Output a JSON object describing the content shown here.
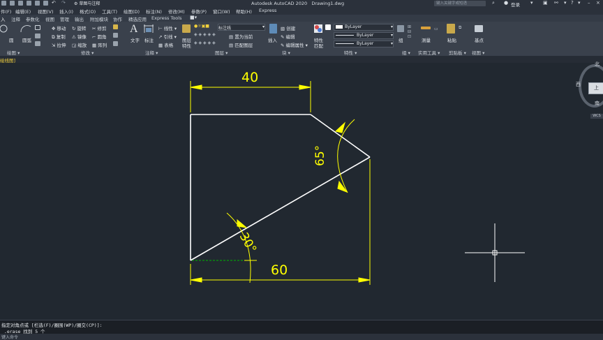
{
  "title": {
    "app_title": "Autodesk AutoCAD 2020",
    "file_name": "Drawing1.dwg",
    "workspace": "草图与注释",
    "search_placeholder": "键入关键字或短语",
    "login": "登录"
  },
  "menu": [
    "件(F)",
    "编辑(E)",
    "视图(V)",
    "插入(I)",
    "格式(O)",
    "工具(T)",
    "绘图(D)",
    "标注(N)",
    "修改(M)",
    "参数(P)",
    "窗口(W)",
    "帮助(H)",
    "Express"
  ],
  "tabs": [
    "入",
    "注释",
    "参数化",
    "视图",
    "管理",
    "输出",
    "附加模块",
    "协作",
    "精选应用",
    "Express Tools"
  ],
  "ribbon": {
    "draw": {
      "circle": "圆",
      "arc": "圆弧",
      "panel": "绘图"
    },
    "modify": {
      "move": "移动",
      "rotate": "旋转",
      "trim": "修剪",
      "copy": "复制",
      "mirror": "镜像",
      "fillet": "圆角",
      "stretch": "拉伸",
      "scale": "缩放",
      "array": "阵列",
      "panel": "修改"
    },
    "annotation": {
      "text": "文字",
      "dimension": "标注",
      "linear": "线性",
      "leader": "引线",
      "table": "表格",
      "panel": "注释"
    },
    "layers": {
      "properties": "图层",
      "properties2": "特性",
      "current_layer": "标注线",
      "make_current": "置为当前",
      "match": "匹配图层",
      "panel": "图层"
    },
    "block": {
      "insert": "插入",
      "create": "创建",
      "edit": "编辑",
      "edit_attr": "编辑属性",
      "panel": "块"
    },
    "properties": {
      "match": "特性",
      "match2": "匹配",
      "color": "ByLayer",
      "linetype": "ByLayer",
      "lineweight": "ByLayer",
      "panel": "特性"
    },
    "groups": {
      "group": "组",
      "panel": "组"
    },
    "utilities": {
      "measure": "测量",
      "panel": "实用工具"
    },
    "clipboard": {
      "paste": "粘贴",
      "panel": "剪贴板"
    },
    "view": {
      "base": "基点",
      "panel": "视图"
    }
  },
  "file_tab": "绘线图]",
  "viewcube": {
    "north": "北",
    "west": "西",
    "south": "南",
    "top": "上",
    "wcs": "WCS"
  },
  "drawing": {
    "dim_top": "40",
    "dim_bottom": "60",
    "angle_top": "65°",
    "angle_bottom": "30°"
  },
  "command": {
    "line1": "指定对角点或 [栏选(F)/圈围(WP)/圈交(CP)]:",
    "line2": "_.erase 找到 5 个",
    "prompt": "键入命令"
  },
  "colors": {
    "geometry": "#ffffff",
    "dimension": "#ffff00",
    "hidden_line": "#00b400",
    "canvas": "#212830"
  }
}
